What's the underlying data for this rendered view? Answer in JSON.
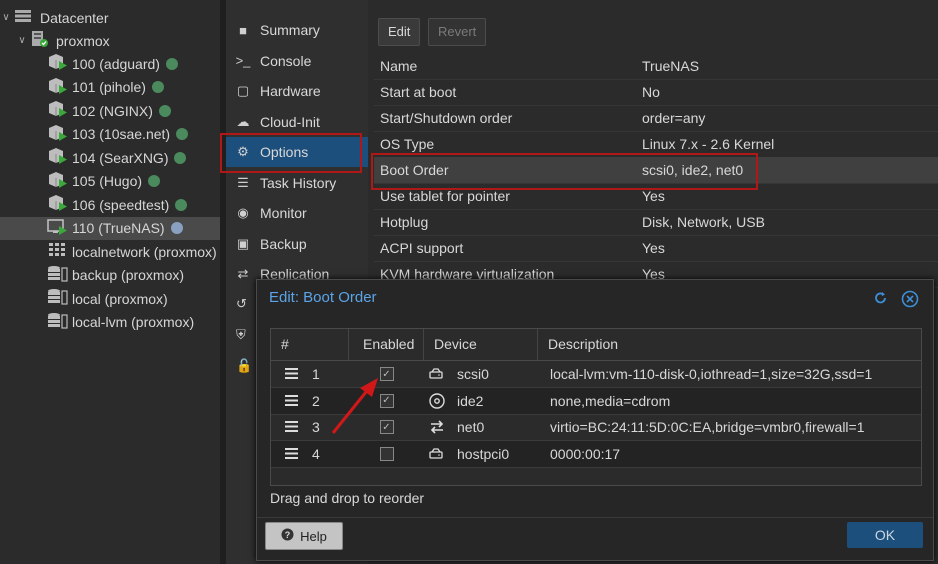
{
  "tree": {
    "datacenter": "Datacenter",
    "node": "proxmox",
    "items": [
      {
        "label": "100 (adguard)",
        "type": "vm",
        "status": "running"
      },
      {
        "label": "101 (pihole)",
        "type": "vm",
        "status": "running"
      },
      {
        "label": "102 (NGINX)",
        "type": "vm",
        "status": "running"
      },
      {
        "label": "103 (10sae.net)",
        "type": "vm",
        "status": "running"
      },
      {
        "label": "104 (SearXNG)",
        "type": "vm",
        "status": "running"
      },
      {
        "label": "105 (Hugo)",
        "type": "vm",
        "status": "running"
      },
      {
        "label": "106 (speedtest)",
        "type": "vm",
        "status": "running"
      },
      {
        "label": "110 (TrueNAS)",
        "type": "vm-stopped",
        "status": "selected"
      },
      {
        "label": "localnetwork (proxmox)",
        "type": "network"
      },
      {
        "label": "backup (proxmox)",
        "type": "storage"
      },
      {
        "label": "local (proxmox)",
        "type": "storage"
      },
      {
        "label": "local-lvm (proxmox)",
        "type": "storage"
      }
    ],
    "colors": {
      "running_dot": "#4b8a5c",
      "selected_dot": "#8aa0c0",
      "vm_arrow": "#3aa83a"
    }
  },
  "nav": {
    "items": [
      {
        "label": "Summary",
        "icon": "book-icon"
      },
      {
        "label": "Console",
        "icon": "terminal-icon"
      },
      {
        "label": "Hardware",
        "icon": "monitor-icon"
      },
      {
        "label": "Cloud-Init",
        "icon": "cloud-icon"
      },
      {
        "label": "Options",
        "icon": "gear-icon"
      },
      {
        "label": "Task History",
        "icon": "list-icon"
      },
      {
        "label": "Monitor",
        "icon": "eye-icon"
      },
      {
        "label": "Backup",
        "icon": "floppy-icon"
      },
      {
        "label": "Replication",
        "icon": "retweet-icon"
      }
    ],
    "active": "Options",
    "accent": "#1d4f7c"
  },
  "toolbar": {
    "edit": "Edit",
    "revert": "Revert"
  },
  "options": [
    {
      "key": "Name",
      "value": "TrueNAS"
    },
    {
      "key": "Start at boot",
      "value": "No"
    },
    {
      "key": "Start/Shutdown order",
      "value": "order=any"
    },
    {
      "key": "OS Type",
      "value": "Linux 7.x - 2.6 Kernel"
    },
    {
      "key": "Boot Order",
      "value": "scsi0, ide2, net0"
    },
    {
      "key": "Use tablet for pointer",
      "value": "Yes"
    },
    {
      "key": "Hotplug",
      "value": "Disk, Network, USB"
    },
    {
      "key": "ACPI support",
      "value": "Yes"
    },
    {
      "key": "KVM hardware virtualization",
      "value": "Yes"
    }
  ],
  "dialog": {
    "title": "Edit: Boot Order",
    "columns": [
      "#",
      "Enabled",
      "Device",
      "Description"
    ],
    "rows": [
      {
        "num": "1",
        "enabled": true,
        "device": "scsi0",
        "device_icon": "hdd-icon",
        "description": "local-lvm:vm-110-disk-0,iothread=1,size=32G,ssd=1"
      },
      {
        "num": "2",
        "enabled": true,
        "device": "ide2",
        "device_icon": "cdrom-icon",
        "description": "none,media=cdrom"
      },
      {
        "num": "3",
        "enabled": true,
        "device": "net0",
        "device_icon": "exchange-icon",
        "description": "virtio=BC:24:11:5D:0C:EA,bridge=vmbr0,firewall=1"
      },
      {
        "num": "4",
        "enabled": false,
        "device": "hostpci0",
        "device_icon": "hdd-icon",
        "description": "0000:00:17"
      }
    ],
    "hint": "Drag and drop to reorder",
    "help": "Help",
    "ok": "OK",
    "title_color": "#5ba4e8"
  },
  "highlight_color": "#b01818"
}
